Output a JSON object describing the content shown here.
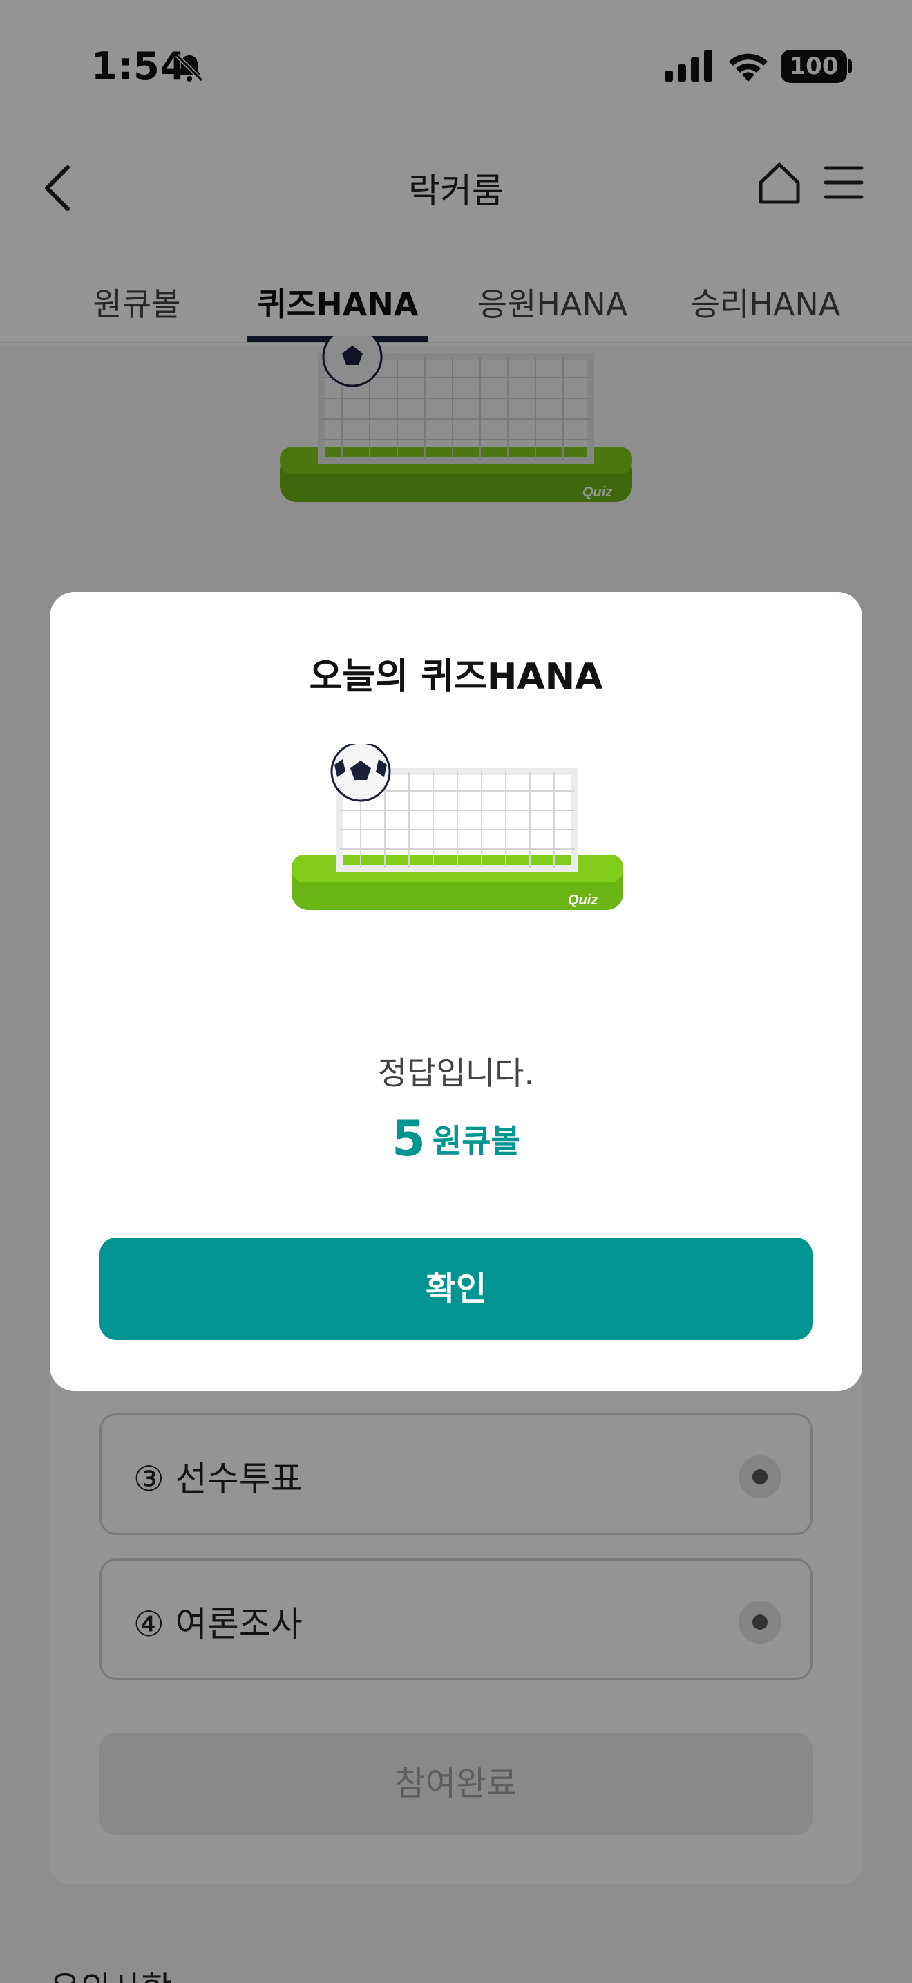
{
  "status_bar": {
    "time": "1:54",
    "battery": "100"
  },
  "header": {
    "title": "락커룸"
  },
  "tabs": [
    {
      "label": "원큐볼",
      "active": false
    },
    {
      "label": "퀴즈HANA",
      "active": true
    },
    {
      "label": "응원HANA",
      "active": false
    },
    {
      "label": "승리HANA",
      "active": false
    }
  ],
  "quiz_image": {
    "badge": "Quiz"
  },
  "options": [
    {
      "label": "③ 선수투표"
    },
    {
      "label": "④ 여론조사"
    }
  ],
  "submit": {
    "label": "참여완료"
  },
  "notice": {
    "title": "유의사항"
  },
  "modal": {
    "title": "오늘의 퀴즈HANA",
    "message": "정답입니다.",
    "reward_amount": "5",
    "reward_unit": "원큐볼",
    "confirm_label": "확인"
  },
  "colors": {
    "accent": "#009590",
    "tab_indicator": "#1c2440"
  }
}
